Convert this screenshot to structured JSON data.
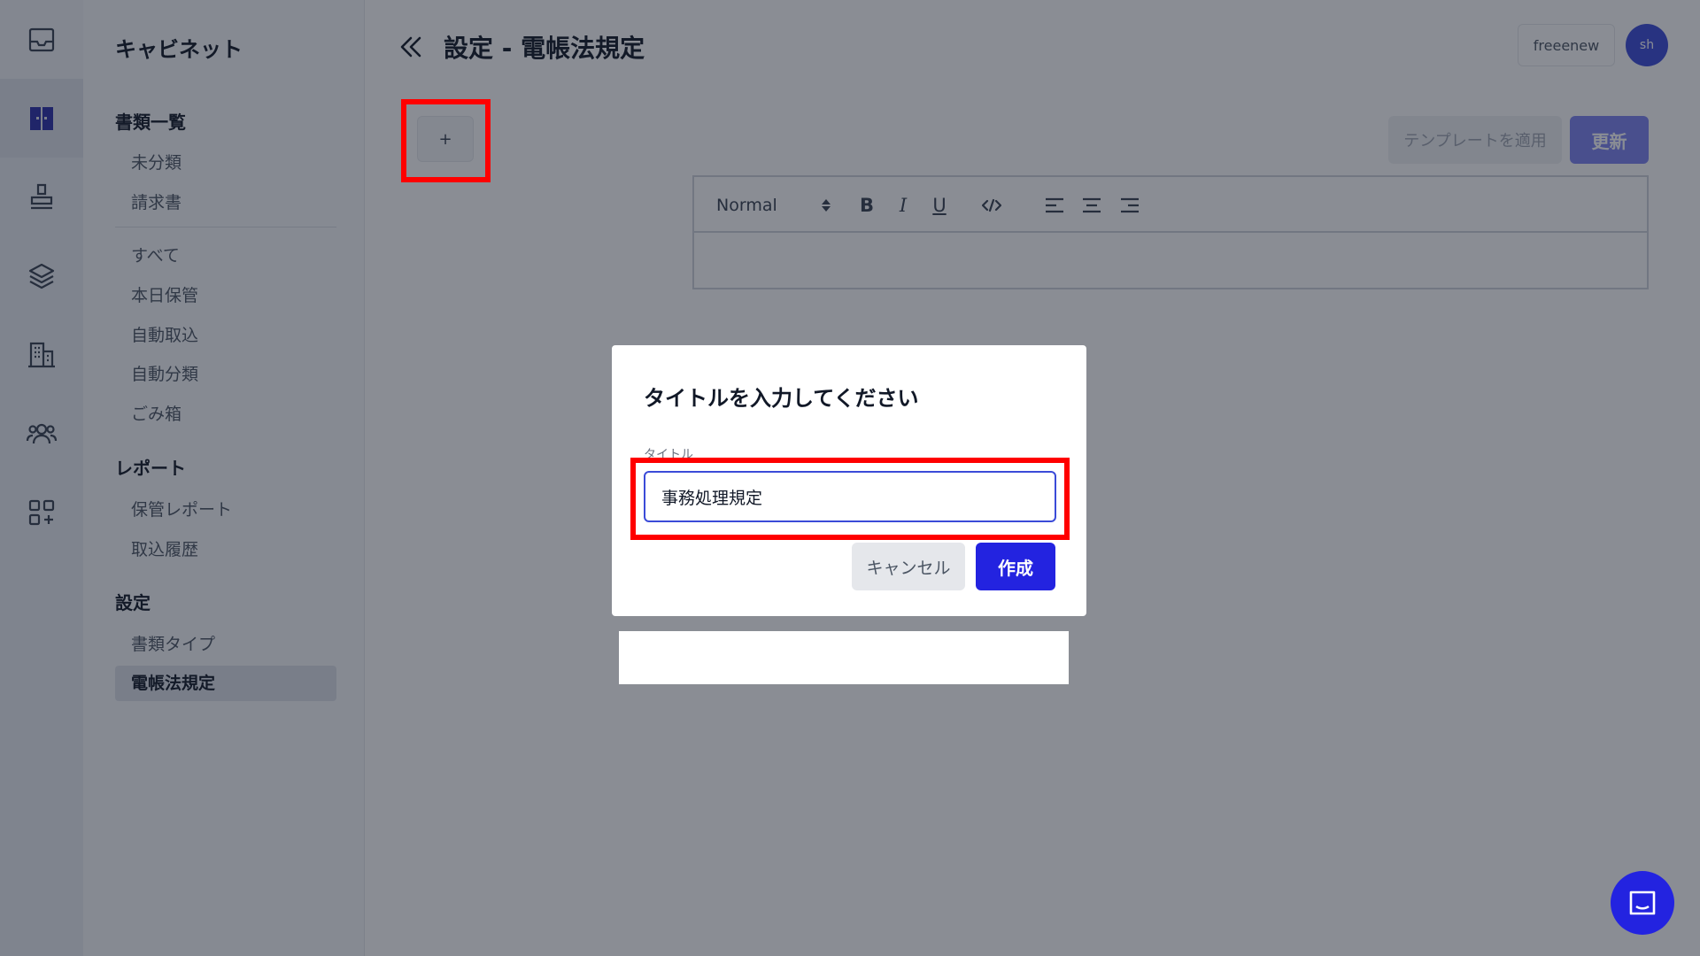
{
  "sidebar": {
    "brand": "キャビネット",
    "sections": [
      {
        "title": "書類一覧",
        "items": [
          "未分類",
          "請求書",
          "すべて",
          "本日保管",
          "自動取込",
          "自動分類",
          "ごみ箱"
        ]
      },
      {
        "title": "レポート",
        "items": [
          "保管レポート",
          "取込履歴"
        ]
      },
      {
        "title": "設定",
        "items": [
          "書類タイプ",
          "電帳法規定"
        ]
      }
    ],
    "active_item": "電帳法規定"
  },
  "header": {
    "title": "設定 - 電帳法規定",
    "user_name": "freeenew",
    "avatar_initials": "sh"
  },
  "toolbar": {
    "add_label": "+",
    "template_label": "テンプレートを適用",
    "update_label": "更新"
  },
  "editor": {
    "format_select": "Normal"
  },
  "dialog": {
    "title": "タイトルを入力してください",
    "field_label": "タイトル",
    "input_value": "事務処理規定",
    "cancel_label": "キャンセル",
    "create_label": "作成"
  },
  "colors": {
    "accent": "#2323e0",
    "highlight": "#ff0000"
  }
}
